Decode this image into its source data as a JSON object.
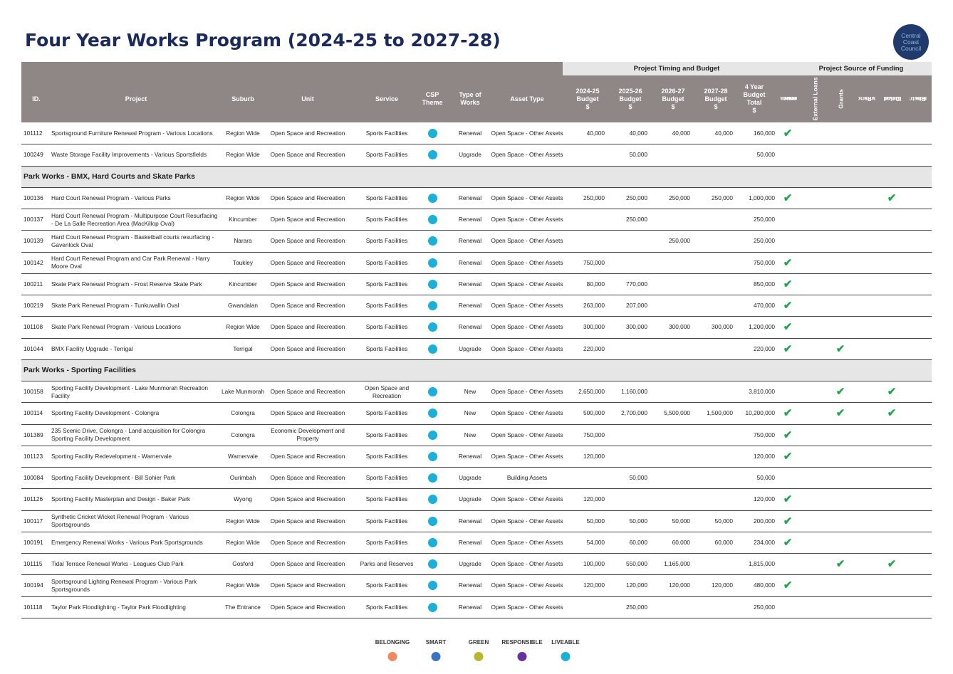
{
  "title": "Four Year Works Program (2024-25 to 2027-28)",
  "logo": {
    "line1": "Central",
    "line2": "Coast",
    "line3": "Council"
  },
  "bands": {
    "budget": "Project Timing and Budget",
    "funding": "Project Source of Funding"
  },
  "headers": {
    "id": "ID.",
    "project": "Project",
    "suburb": "Suburb",
    "unit": "Unit",
    "service": "Service",
    "csp_1": "CSP",
    "csp_2": "Theme",
    "works_1": "Type of",
    "works_2": "Works",
    "asset": "Asset Type",
    "y1_1": "2024-25",
    "y1_2": "Budget",
    "y1_3": "$",
    "y2_1": "2025-26",
    "y2_2": "Budget",
    "y2_3": "$",
    "y3_1": "2026-27",
    "y3_2": "Budget",
    "y3_3": "$",
    "y4_1": "2027-28",
    "y4_2": "Budget",
    "y4_3": "$",
    "tot_1": "4 Year",
    "tot_2": "Budget",
    "tot_3": "Total",
    "tot_4": "$",
    "gfr_1": "General Fund",
    "gfr_2": "Revenue",
    "ext": "External Loans",
    "grants": "Grants",
    "pend_1": "Pending",
    "pend_2": "Grants",
    "dev_1": "Developer",
    "dev_2": "Contributions",
    "rest_1": "Restricted",
    "rest_2": "Funds"
  },
  "colors": {
    "liveable": "#1ab0d8",
    "tick": "#21a64a",
    "header": "#8f8785"
  },
  "rows": [
    {
      "id": "101112",
      "project": "Sportsground Furniture Renewal Program - Various Locations",
      "suburb": "Region Wide",
      "unit": "Open Space and Recreation",
      "service": "Sports Facilities",
      "works": "Renewal",
      "asset": "Open Space - Other Assets",
      "y1": "40,000",
      "y2": "40,000",
      "y3": "40,000",
      "y4": "40,000",
      "total": "160,000",
      "f": [
        1,
        0,
        0,
        0,
        0,
        0
      ]
    },
    {
      "id": "100249",
      "project": "Waste Storage Facility Improvements - Various Sportsfields",
      "suburb": "Region Wide",
      "unit": "Open Space and Recreation",
      "service": "Sports Facilities",
      "works": "Upgrade",
      "asset": "Open Space - Other Assets",
      "y1": "",
      "y2": "50,000",
      "y3": "",
      "y4": "",
      "total": "50,000",
      "f": [
        0,
        0,
        0,
        0,
        0,
        0
      ]
    },
    {
      "section": "Park Works - BMX, Hard Courts and Skate Parks"
    },
    {
      "id": "100136",
      "project": "Hard Court Renewal Program - Various Parks",
      "suburb": "Region Wide",
      "unit": "Open Space and Recreation",
      "service": "Sports Facilities",
      "works": "Renewal",
      "asset": "Open Space - Other Assets",
      "y1": "250,000",
      "y2": "250,000",
      "y3": "250,000",
      "y4": "250,000",
      "total": "1,000,000",
      "f": [
        1,
        0,
        0,
        0,
        1,
        0
      ]
    },
    {
      "id": "100137",
      "project": "Hard Court Renewal Program - Multipurpose Court Resurfacing - De La Salle Recreation Area (MacKillop Oval)",
      "suburb": "Kincumber",
      "unit": "Open Space and Recreation",
      "service": "Sports Facilities",
      "works": "Renewal",
      "asset": "Open Space - Other Assets",
      "y1": "",
      "y2": "250,000",
      "y3": "",
      "y4": "",
      "total": "250,000",
      "f": [
        0,
        0,
        0,
        0,
        0,
        0
      ]
    },
    {
      "id": "100139",
      "project": "Hard Court Renewal Program - Basketball courts resurfacing - Gavenlock Oval",
      "suburb": "Narara",
      "unit": "Open Space and Recreation",
      "service": "Sports Facilities",
      "works": "Renewal",
      "asset": "Open Space - Other Assets",
      "y1": "",
      "y2": "",
      "y3": "250,000",
      "y4": "",
      "total": "250,000",
      "f": [
        0,
        0,
        0,
        0,
        0,
        0
      ]
    },
    {
      "id": "100142",
      "project": "Hard Court Renewal Program and Car Park Renewal - Harry Moore Oval",
      "suburb": "Toukley",
      "unit": "Open Space and Recreation",
      "service": "Sports Facilities",
      "works": "Renewal",
      "asset": "Open Space - Other Assets",
      "y1": "750,000",
      "y2": "",
      "y3": "",
      "y4": "",
      "total": "750,000",
      "f": [
        1,
        0,
        0,
        0,
        0,
        0
      ]
    },
    {
      "id": "100211",
      "project": "Skate Park Renewal Program - Frost Reserve Skate Park",
      "suburb": "Kincumber",
      "unit": "Open Space and Recreation",
      "service": "Sports Facilities",
      "works": "Renewal",
      "asset": "Open Space - Other Assets",
      "y1": "80,000",
      "y2": "770,000",
      "y3": "",
      "y4": "",
      "total": "850,000",
      "f": [
        1,
        0,
        0,
        0,
        0,
        0
      ]
    },
    {
      "id": "100219",
      "project": "Skate Park Renewal Program - Tunkuwallin Oval",
      "suburb": "Gwandalan",
      "unit": "Open Space and Recreation",
      "service": "Sports Facilities",
      "works": "Renewal",
      "asset": "Open Space - Other Assets",
      "y1": "263,000",
      "y2": "207,000",
      "y3": "",
      "y4": "",
      "total": "470,000",
      "f": [
        1,
        0,
        0,
        0,
        0,
        0
      ]
    },
    {
      "id": "101108",
      "project": "Skate Park Renewal Program - Various Locations",
      "suburb": "Region Wide",
      "unit": "Open Space and Recreation",
      "service": "Sports Facilities",
      "works": "Renewal",
      "asset": "Open Space - Other Assets",
      "y1": "300,000",
      "y2": "300,000",
      "y3": "300,000",
      "y4": "300,000",
      "total": "1,200,000",
      "f": [
        1,
        0,
        0,
        0,
        0,
        0
      ]
    },
    {
      "id": "101044",
      "project": "BMX Facility Upgrade - Terrigal",
      "suburb": "Terrigal",
      "unit": "Open Space and Recreation",
      "service": "Sports Facilities",
      "works": "Upgrade",
      "asset": "Open Space - Other Assets",
      "y1": "220,000",
      "y2": "",
      "y3": "",
      "y4": "",
      "total": "220,000",
      "f": [
        1,
        0,
        1,
        0,
        0,
        0
      ]
    },
    {
      "section": "Park Works - Sporting Facilities"
    },
    {
      "id": "100158",
      "project": "Sporting Facility Development - Lake Munmorah Recreation Facility",
      "suburb": "Lake Munmorah",
      "unit": "Open Space and Recreation",
      "service": "Open Space and Recreation",
      "works": "New",
      "asset": "Open Space - Other Assets",
      "y1": "2,650,000",
      "y2": "1,160,000",
      "y3": "",
      "y4": "",
      "total": "3,810,000",
      "f": [
        0,
        0,
        1,
        0,
        1,
        0
      ]
    },
    {
      "id": "100114",
      "project": "Sporting Facility Development - Colongra",
      "suburb": "Colongra",
      "unit": "Open Space and Recreation",
      "service": "Sports Facilities",
      "works": "New",
      "asset": "Open Space - Other Assets",
      "y1": "500,000",
      "y2": "2,700,000",
      "y3": "5,500,000",
      "y4": "1,500,000",
      "total": "10,200,000",
      "f": [
        1,
        0,
        1,
        0,
        1,
        0
      ]
    },
    {
      "id": "101389",
      "project": "235 Scenic Drive, Colongra - Land acquisition for Colongra Sporting Facility Development",
      "suburb": "Colongra",
      "unit": "Economic Development and Property",
      "service": "Sports Facilities",
      "works": "New",
      "asset": "Open Space - Other Assets",
      "y1": "750,000",
      "y2": "",
      "y3": "",
      "y4": "",
      "total": "750,000",
      "f": [
        1,
        0,
        0,
        0,
        0,
        0
      ]
    },
    {
      "id": "101123",
      "project": "Sporting Facility Redevelopment - Warnervale",
      "suburb": "Warnervale",
      "unit": "Open Space and Recreation",
      "service": "Sports Facilities",
      "works": "Renewal",
      "asset": "Open Space - Other Assets",
      "y1": "120,000",
      "y2": "",
      "y3": "",
      "y4": "",
      "total": "120,000",
      "f": [
        1,
        0,
        0,
        0,
        0,
        0
      ]
    },
    {
      "id": "100084",
      "project": "Sporting Facility Development - Bill Sohier Park",
      "suburb": "Ourimbah",
      "unit": "Open Space and Recreation",
      "service": "Sports Facilities",
      "works": "Upgrade",
      "asset": "Building Assets",
      "y1": "",
      "y2": "50,000",
      "y3": "",
      "y4": "",
      "total": "50,000",
      "f": [
        0,
        0,
        0,
        0,
        0,
        0
      ]
    },
    {
      "id": "101126",
      "project": "Sporting Facility Masterplan and Design - Baker Park",
      "suburb": "Wyong",
      "unit": "Open Space and Recreation",
      "service": "Sports Facilities",
      "works": "Upgrade",
      "asset": "Open Space - Other Assets",
      "y1": "120,000",
      "y2": "",
      "y3": "",
      "y4": "",
      "total": "120,000",
      "f": [
        1,
        0,
        0,
        0,
        0,
        0
      ]
    },
    {
      "id": "100117",
      "project": "Synthetic Cricket Wicket Renewal Program - Various Sportsgrounds",
      "suburb": "Region Wide",
      "unit": "Open Space and Recreation",
      "service": "Sports Facilities",
      "works": "Renewal",
      "asset": "Open Space - Other Assets",
      "y1": "50,000",
      "y2": "50,000",
      "y3": "50,000",
      "y4": "50,000",
      "total": "200,000",
      "f": [
        1,
        0,
        0,
        0,
        0,
        0
      ]
    },
    {
      "id": "100191",
      "project": "Emergency Renewal Works - Various Park Sportsgrounds",
      "suburb": "Region Wide",
      "unit": "Open Space and Recreation",
      "service": "Sports Facilities",
      "works": "Renewal",
      "asset": "Open Space - Other Assets",
      "y1": "54,000",
      "y2": "60,000",
      "y3": "60,000",
      "y4": "60,000",
      "total": "234,000",
      "f": [
        1,
        0,
        0,
        0,
        0,
        0
      ]
    },
    {
      "id": "101115",
      "project": "Tidal Terrace Renewal Works - Leagues Club Park",
      "suburb": "Gosford",
      "unit": "Open Space and Recreation",
      "service": "Parks and Reserves",
      "works": "Upgrade",
      "asset": "Open Space - Other Assets",
      "y1": "100,000",
      "y2": "550,000",
      "y3": "1,165,000",
      "y4": "",
      "total": "1,815,000",
      "f": [
        0,
        0,
        1,
        0,
        1,
        0
      ]
    },
    {
      "id": "100194",
      "project": "Sportsground Lighting Renewal Program - Various Park Sportsgrounds",
      "suburb": "Region Wide",
      "unit": "Open Space and Recreation",
      "service": "Sports Facilities",
      "works": "Renewal",
      "asset": "Open Space - Other Assets",
      "y1": "120,000",
      "y2": "120,000",
      "y3": "120,000",
      "y4": "120,000",
      "total": "480,000",
      "f": [
        1,
        0,
        0,
        0,
        0,
        0
      ]
    },
    {
      "id": "101118",
      "project": "Taylor Park Floodlighting - Taylor Park Floodlighting",
      "suburb": "The Entrance",
      "unit": "Open Space and Recreation",
      "service": "Sports Facilities",
      "works": "Renewal",
      "asset": "Open Space - Other Assets",
      "y1": "",
      "y2": "250,000",
      "y3": "",
      "y4": "",
      "total": "250,000",
      "f": [
        0,
        0,
        0,
        0,
        0,
        0
      ]
    }
  ],
  "legend": [
    {
      "label": "BELONGING",
      "color": "#f08a5d"
    },
    {
      "label": "SMART",
      "color": "#3a73c4"
    },
    {
      "label": "GREEN",
      "color": "#b5b82a"
    },
    {
      "label": "RESPONSIBLE",
      "color": "#6a2fa0"
    },
    {
      "label": "LIVEABLE",
      "color": "#1ab0d8"
    }
  ]
}
